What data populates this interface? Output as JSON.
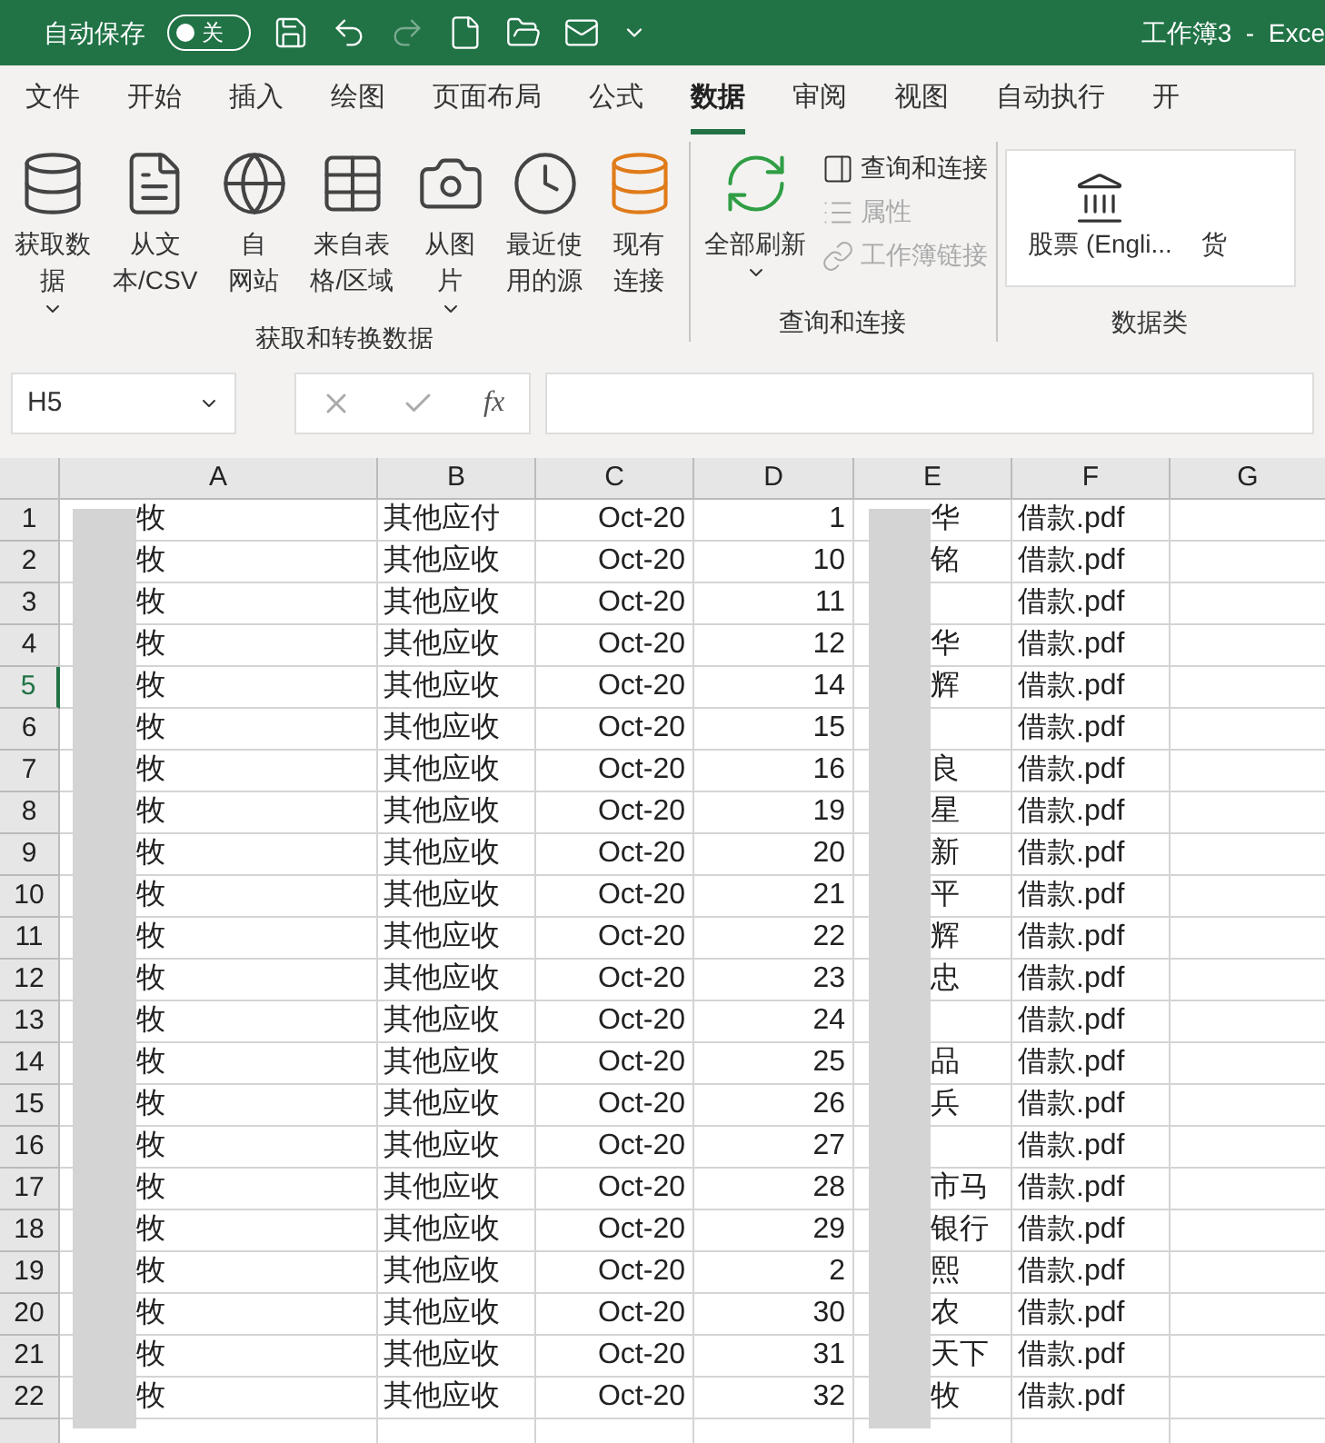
{
  "title_bar": {
    "autosave_label": "自动保存",
    "autosave_toggle": {
      "on": false,
      "label": "关"
    },
    "title": "工作簿3  -  Exce"
  },
  "tabs": [
    {
      "label": "文件",
      "selected": false
    },
    {
      "label": "开始",
      "selected": false
    },
    {
      "label": "插入",
      "selected": false
    },
    {
      "label": "绘图",
      "selected": false
    },
    {
      "label": "页面布局",
      "selected": false
    },
    {
      "label": "公式",
      "selected": false
    },
    {
      "label": "数据",
      "selected": true
    },
    {
      "label": "审阅",
      "selected": false
    },
    {
      "label": "视图",
      "selected": false
    },
    {
      "label": "自动执行",
      "selected": false
    },
    {
      "label": "开",
      "selected": false
    }
  ],
  "ribbon": {
    "groups": [
      {
        "title": "获取和转换数据",
        "buttons": [
          {
            "label_lines": [
              "获取数",
              "据"
            ],
            "dropdown": true
          },
          {
            "label_lines": [
              "从文",
              "本/CSV"
            ],
            "dropdown": false
          },
          {
            "label_lines": [
              "自",
              "网站"
            ],
            "dropdown": false
          },
          {
            "label_lines": [
              "来自表",
              "格/区域"
            ],
            "dropdown": false
          },
          {
            "label_lines": [
              "从图",
              "片"
            ],
            "dropdown": true
          },
          {
            "label_lines": [
              "最近使",
              "用的源"
            ],
            "dropdown": false
          },
          {
            "label_lines": [
              "现有",
              "连接"
            ],
            "dropdown": false
          }
        ]
      },
      {
        "title": "查询和连接",
        "buttons": [
          {
            "label_lines": [
              "全部刷新"
            ],
            "dropdown": true
          }
        ],
        "small_buttons": [
          {
            "label": "查询和连接",
            "disabled": false
          },
          {
            "label": "属性",
            "disabled": true
          },
          {
            "label": "工作簿链接",
            "disabled": true
          }
        ]
      },
      {
        "title": "数据类",
        "gallery": [
          "股票 (Engli...",
          "货"
        ]
      }
    ]
  },
  "formula_bar": {
    "name_box": "H5",
    "function_label": "fx"
  },
  "sheet": {
    "columns": [
      "A",
      "B",
      "C",
      "D",
      "E",
      "F",
      "G"
    ],
    "rows": [
      {
        "number": "1",
        "selected": false,
        "a": "牧",
        "b": "其他应付",
        "c": "Oct-20",
        "d": "1",
        "e": "华",
        "f": "借款.pdf"
      },
      {
        "number": "2",
        "selected": false,
        "a": "牧",
        "b": "其他应收",
        "c": "Oct-20",
        "d": "10",
        "e": "铭",
        "f": "借款.pdf"
      },
      {
        "number": "3",
        "selected": false,
        "a": "牧",
        "b": "其他应收",
        "c": "Oct-20",
        "d": "11",
        "e": "",
        "f": "借款.pdf"
      },
      {
        "number": "4",
        "selected": false,
        "a": "牧",
        "b": "其他应收",
        "c": "Oct-20",
        "d": "12",
        "e": "华",
        "f": "借款.pdf"
      },
      {
        "number": "5",
        "selected": true,
        "a": "牧",
        "b": "其他应收",
        "c": "Oct-20",
        "d": "14",
        "e": "辉",
        "f": "借款.pdf"
      },
      {
        "number": "6",
        "selected": false,
        "a": "牧",
        "b": "其他应收",
        "c": "Oct-20",
        "d": "15",
        "e": "",
        "f": "借款.pdf"
      },
      {
        "number": "7",
        "selected": false,
        "a": "牧",
        "b": "其他应收",
        "c": "Oct-20",
        "d": "16",
        "e": "良",
        "f": "借款.pdf"
      },
      {
        "number": "8",
        "selected": false,
        "a": "牧",
        "b": "其他应收",
        "c": "Oct-20",
        "d": "19",
        "e": "星",
        "f": "借款.pdf"
      },
      {
        "number": "9",
        "selected": false,
        "a": "牧",
        "b": "其他应收",
        "c": "Oct-20",
        "d": "20",
        "e": "新",
        "f": "借款.pdf"
      },
      {
        "number": "10",
        "selected": false,
        "a": "牧",
        "b": "其他应收",
        "c": "Oct-20",
        "d": "21",
        "e": "平",
        "f": "借款.pdf"
      },
      {
        "number": "11",
        "selected": false,
        "a": "牧",
        "b": "其他应收",
        "c": "Oct-20",
        "d": "22",
        "e": "辉",
        "f": "借款.pdf"
      },
      {
        "number": "12",
        "selected": false,
        "a": "牧",
        "b": "其他应收",
        "c": "Oct-20",
        "d": "23",
        "e": "忠",
        "f": "借款.pdf"
      },
      {
        "number": "13",
        "selected": false,
        "a": "牧",
        "b": "其他应收",
        "c": "Oct-20",
        "d": "24",
        "e": "",
        "f": "借款.pdf"
      },
      {
        "number": "14",
        "selected": false,
        "a": "牧",
        "b": "其他应收",
        "c": "Oct-20",
        "d": "25",
        "e": "品",
        "f": "借款.pdf"
      },
      {
        "number": "15",
        "selected": false,
        "a": "牧",
        "b": "其他应收",
        "c": "Oct-20",
        "d": "26",
        "e": "兵",
        "f": "借款.pdf"
      },
      {
        "number": "16",
        "selected": false,
        "a": "牧",
        "b": "其他应收",
        "c": "Oct-20",
        "d": "27",
        "e": "",
        "f": "借款.pdf"
      },
      {
        "number": "17",
        "selected": false,
        "a": "牧",
        "b": "其他应收",
        "c": "Oct-20",
        "d": "28",
        "e": "市马",
        "f": "借款.pdf"
      },
      {
        "number": "18",
        "selected": false,
        "a": "牧",
        "b": "其他应收",
        "c": "Oct-20",
        "d": "29",
        "e": "银行",
        "f": "借款.pdf"
      },
      {
        "number": "19",
        "selected": false,
        "a": "牧",
        "b": "其他应收",
        "c": "Oct-20",
        "d": "2",
        "e": "熙",
        "f": "借款.pdf"
      },
      {
        "number": "20",
        "selected": false,
        "a": "牧",
        "b": "其他应收",
        "c": "Oct-20",
        "d": "30",
        "e": "农",
        "f": "借款.pdf"
      },
      {
        "number": "21",
        "selected": false,
        "a": "牧",
        "b": "其他应收",
        "c": "Oct-20",
        "d": "31",
        "e": "天下",
        "f": "借款.pdf"
      },
      {
        "number": "22",
        "selected": false,
        "a": "牧",
        "b": "其他应收",
        "c": "Oct-20",
        "d": "32",
        "e": "牧",
        "f": "借款.pdf"
      }
    ]
  }
}
